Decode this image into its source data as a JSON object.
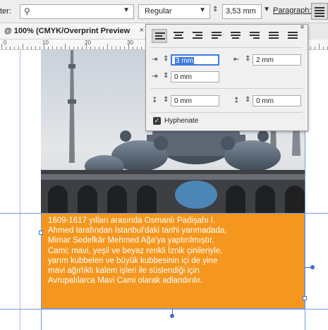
{
  "toolbar": {
    "filter_label": "ter:",
    "search_placeholder": "",
    "font_style": "Regular",
    "leading_value": "3,53 mm",
    "paragraph_label": "Paragraph:"
  },
  "document_tab": {
    "title": "@ 100% (CMYK/Overprint Preview",
    "close": "×"
  },
  "ruler": {
    "labels": [
      "0",
      "10",
      "20",
      "30"
    ]
  },
  "paragraph_panel": {
    "left_indent": "3 mm",
    "right_indent": "2 mm",
    "first_line_indent": "0 mm",
    "space_before": "0 mm",
    "space_after": "0 mm",
    "hyphenate_label": "Hyphenate",
    "hyphenate_checked": true
  },
  "text_frame": {
    "lines": [
      "1609-1617 yılları arasında Osmanlı Padişahı I.",
      "Ahmed tarafından İstanbul'daki tarihi yarımadada,",
      "Mimar Sedefkâr Mehmed Ağa'ya yaptırılmıştır.",
      "Cami; mavi, yeşil ve beyaz renkli İznik çinileriyle,",
      "yarım kubbeleri ve büyük kubbesinin içi de yine",
      "mavi ağırlıklı kalem işleri ile süslendiği için",
      "Avrupalılarca Mavi Cami olarak adlandırılır."
    ],
    "fill_color": "#f5971f"
  },
  "photo": {
    "subject": "Blue Mosque (Sultan Ahmed Mosque), Istanbul"
  }
}
